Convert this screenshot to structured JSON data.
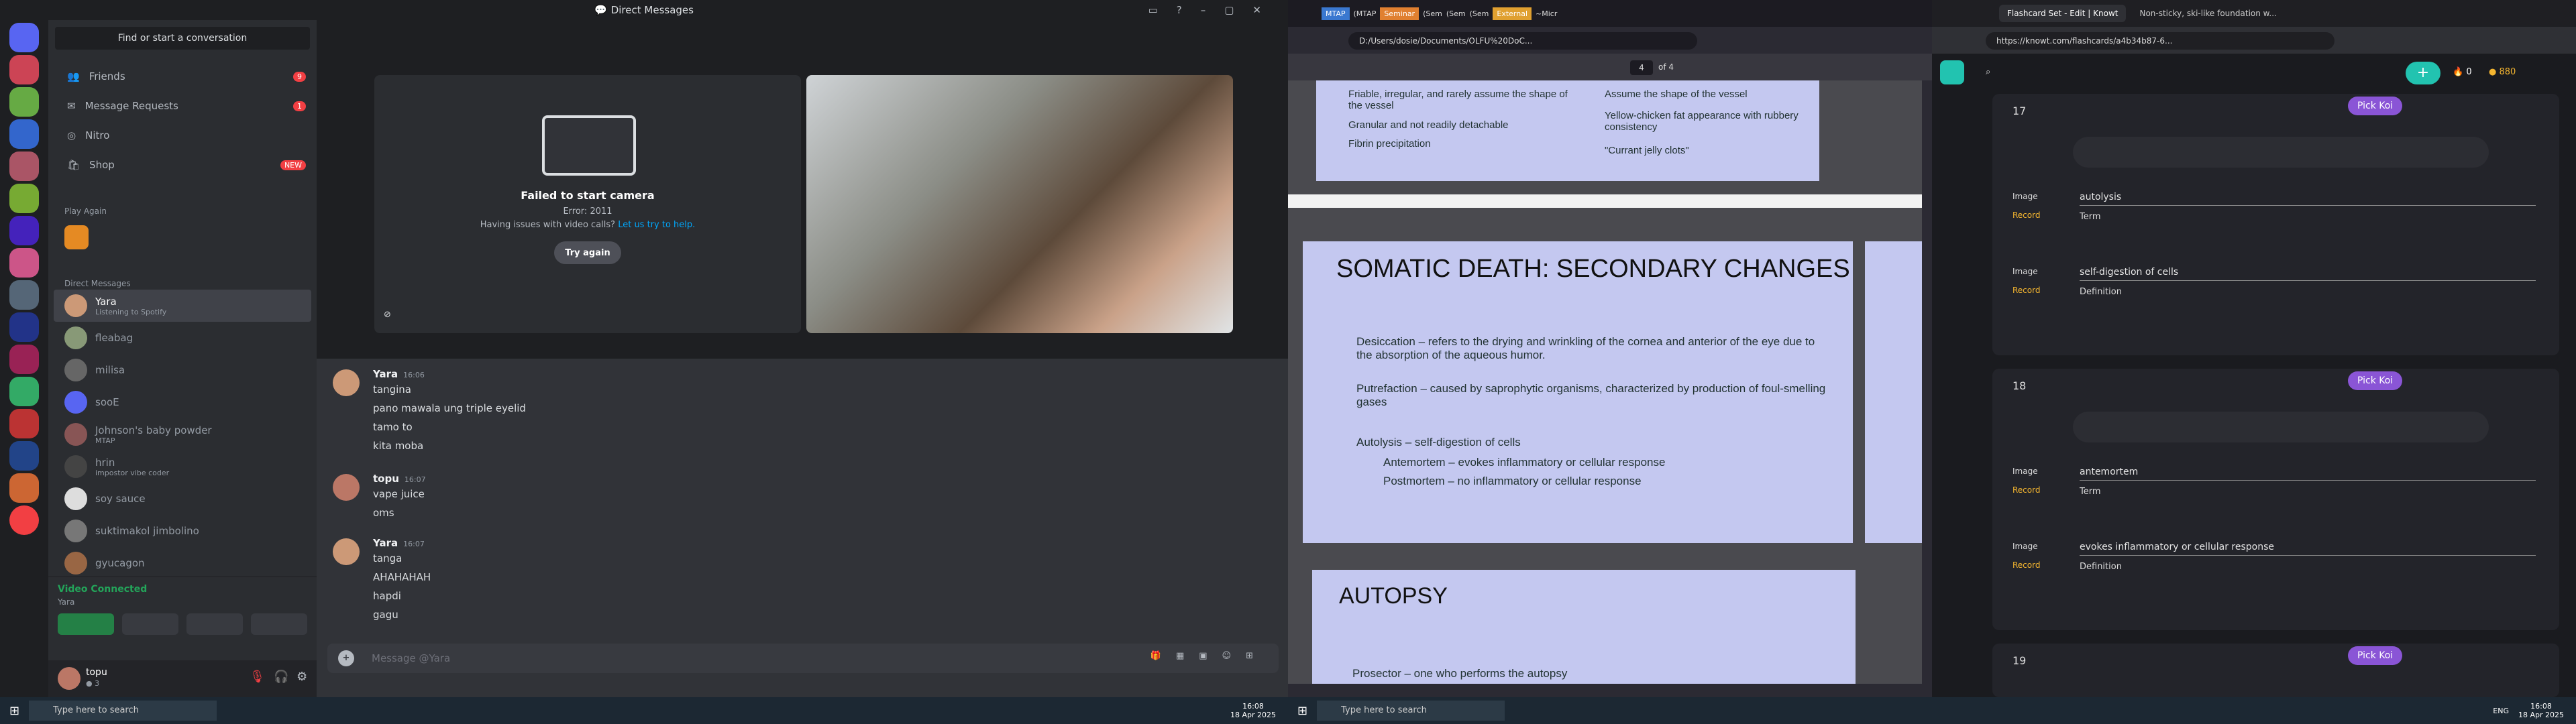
{
  "discord": {
    "window_title": "Direct Messages",
    "search_placeholder": "Find or start a conversation",
    "nav": [
      {
        "label": "Friends",
        "badge": "9"
      },
      {
        "label": "Message Requests",
        "badge": "1"
      },
      {
        "label": "Nitro",
        "badge": ""
      },
      {
        "label": "Shop",
        "badge": "NEW"
      }
    ],
    "play_again_label": "Play Again",
    "dm_header": "Direct Messages",
    "dms": [
      {
        "name": "Yara",
        "sub": "Listening to Spotify"
      },
      {
        "name": "fleabag",
        "sub": ""
      },
      {
        "name": "milisa",
        "sub": ""
      },
      {
        "name": "sooE",
        "sub": ""
      },
      {
        "name": "Johnson's baby powder",
        "sub": "MTAP"
      },
      {
        "name": "hrin",
        "sub": "impostor vibe coder"
      },
      {
        "name": "soy sauce",
        "sub": ""
      },
      {
        "name": "suktimakol jimbolino",
        "sub": ""
      },
      {
        "name": "gyucagon",
        "sub": ""
      }
    ],
    "voice": {
      "status": "Video Connected",
      "channel": "Yara"
    },
    "user": {
      "name": "topu",
      "status": "● 3"
    },
    "camera_error": {
      "title": "Failed to start camera",
      "error": "Error: 2011",
      "help_prefix": "Having issues with video calls?",
      "help_link": "Let us try to help.",
      "button": "Try again"
    },
    "messages": [
      {
        "author": "Yara",
        "time": "16:06",
        "lines": [
          "tangina",
          "pano mawala ung triple eyelid",
          "tamo to",
          "kita moba"
        ]
      },
      {
        "author": "topu",
        "time": "16:07",
        "lines": [
          "vape juice",
          "oms"
        ]
      },
      {
        "author": "Yara",
        "time": "16:07",
        "lines": [
          "tanga",
          "AHAHAHAH",
          "hapdi",
          "gagu"
        ]
      }
    ],
    "input_placeholder": "Message @Yara"
  },
  "pdf": {
    "tabs": [
      "MTAP",
      "(MTAP",
      "Seminar",
      "(Sem",
      "(Sem",
      "(Sem",
      "External",
      "~Micr"
    ],
    "address": "D:/Users/dosie/Documents/OLFU%20DoC...",
    "page_current": "4",
    "page_total": "of 4",
    "slide_top": {
      "left": [
        "Friable, irregular, and rarely assume the shape of the vessel",
        "Granular and not readily detachable",
        "Fibrin precipitation"
      ],
      "right": [
        "Assume the shape of the vessel",
        "Yellow-chicken fat appearance with rubbery consistency",
        "\"Currant jelly clots\""
      ]
    },
    "slide_main": {
      "title": "SOMATIC DEATH: SECONDARY CHANGES",
      "bullets": [
        "Desiccation – refers to the drying and wrinkling of the cornea and anterior of the eye due to the absorption of the aqueous humor.",
        "Putrefaction – caused by saprophytic organisms, characterized by production of foul-smelling gases",
        "Autolysis – self-digestion of cells"
      ],
      "sub": [
        "Antemortem – evokes inflammatory or cellular response",
        "Postmortem – no inflammatory or cellular response"
      ]
    },
    "slide_next_title": "AUTOPSY",
    "slide_next_line": "Prosector – one who performs the autopsy"
  },
  "knowt": {
    "tabs": [
      "Flashcard Set - Edit | Knowt",
      "Non-sticky, ski-like foundation w..."
    ],
    "url": "https://knowt.com/flashcards/a4b34b87-6...",
    "streak": "0",
    "coins": "880",
    "cards": [
      {
        "num": "17",
        "term": "autolysis",
        "definition": "self-digestion of cells"
      },
      {
        "num": "18",
        "term": "antemortem",
        "definition": "evokes inflammatory or cellular response"
      },
      {
        "num": "19",
        "term": "",
        "definition": ""
      }
    ],
    "pick_label": "Pick Koi",
    "image_label": "Image",
    "record_label": "Record",
    "term_label": "Term",
    "definition_label": "Definition"
  },
  "taskbar": {
    "search": "Type here to search",
    "time": "16:08",
    "date": "18 Apr 2025",
    "lang": "ENG"
  }
}
